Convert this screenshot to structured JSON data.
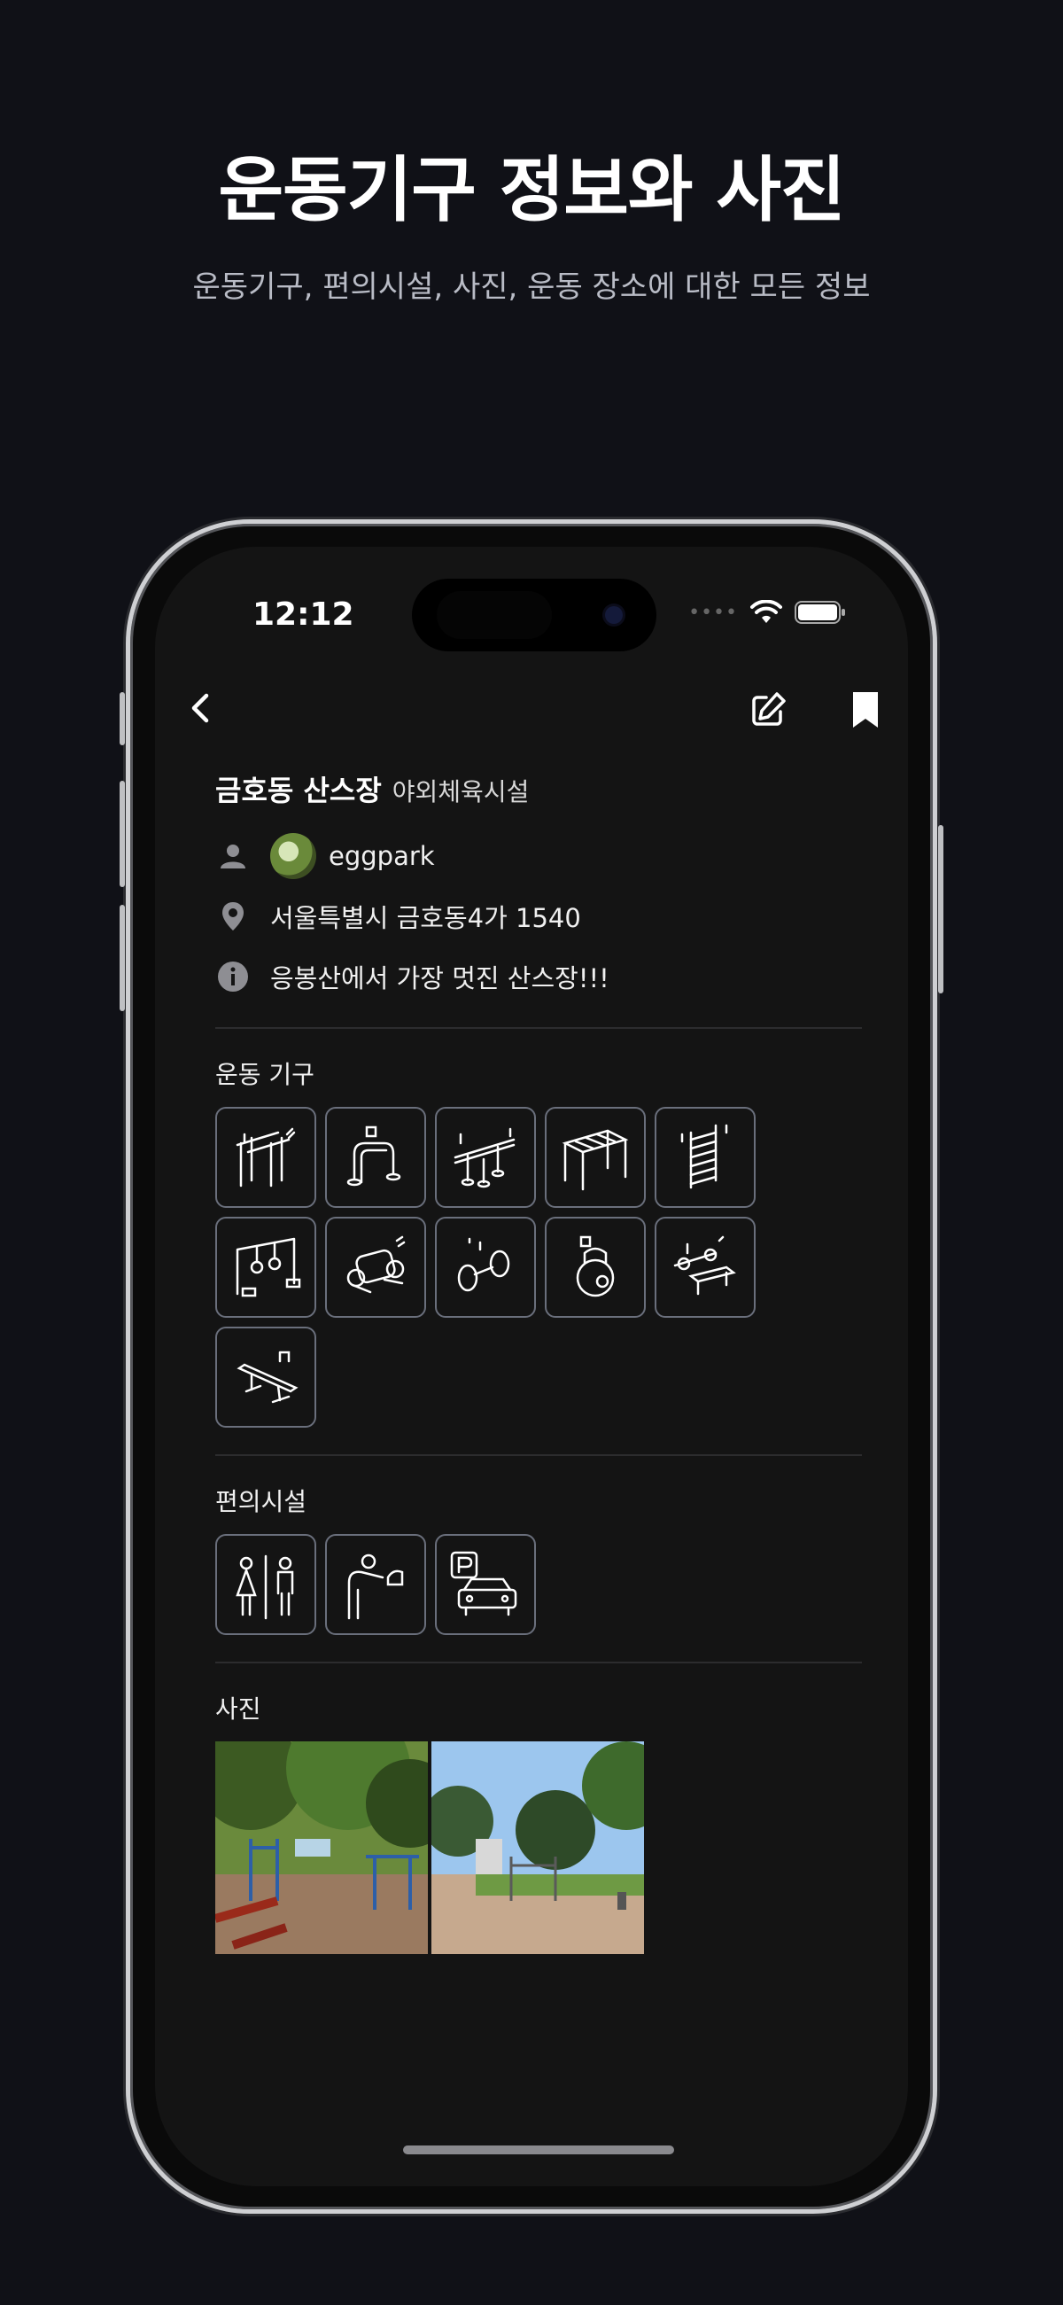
{
  "hero": {
    "title": "운동기구 정보와 사진",
    "subtitle": "운동기구, 편의시설, 사진, 운동 장소에 대한 모든 정보"
  },
  "status_bar": {
    "time": "12:12",
    "icons": [
      "signal-dots-icon",
      "wifi-icon",
      "battery-icon"
    ]
  },
  "nav": {
    "back_icon": "chevron-left-icon",
    "edit_icon": "edit-icon",
    "bookmark_icon": "bookmark-icon"
  },
  "place": {
    "name": "금호동 산스장",
    "category": "야외체육시설",
    "author": "eggpark",
    "address": "서울특별시 금호동4가 1540",
    "description": "응봉산에서 가장 멋진 산스장!!!"
  },
  "sections": {
    "equipment_label": "운동 기구",
    "amenities_label": "편의시설",
    "photos_label": "사진"
  },
  "equipment": [
    {
      "icon": "parallel-bars-icon"
    },
    {
      "icon": "dip-bars-icon"
    },
    {
      "icon": "low-bars-icon"
    },
    {
      "icon": "monkey-bars-icon"
    },
    {
      "icon": "wall-ladder-icon"
    },
    {
      "icon": "gymnastic-rings-icon"
    },
    {
      "icon": "leg-machine-icon"
    },
    {
      "icon": "dumbbell-icon"
    },
    {
      "icon": "kettlebell-icon"
    },
    {
      "icon": "bench-press-icon"
    },
    {
      "icon": "incline-bench-icon"
    }
  ],
  "amenities": [
    {
      "icon": "restroom-icon"
    },
    {
      "icon": "drinking-fountain-icon"
    },
    {
      "icon": "parking-icon"
    }
  ],
  "photos": [
    {
      "icon": "photo-forest-outdoor-gym"
    },
    {
      "icon": "photo-park-plaza"
    }
  ],
  "colors": {
    "background": "#101117",
    "screen": "#141414",
    "tile_border": "#6a6f7c",
    "divider": "#2c2c2e"
  }
}
